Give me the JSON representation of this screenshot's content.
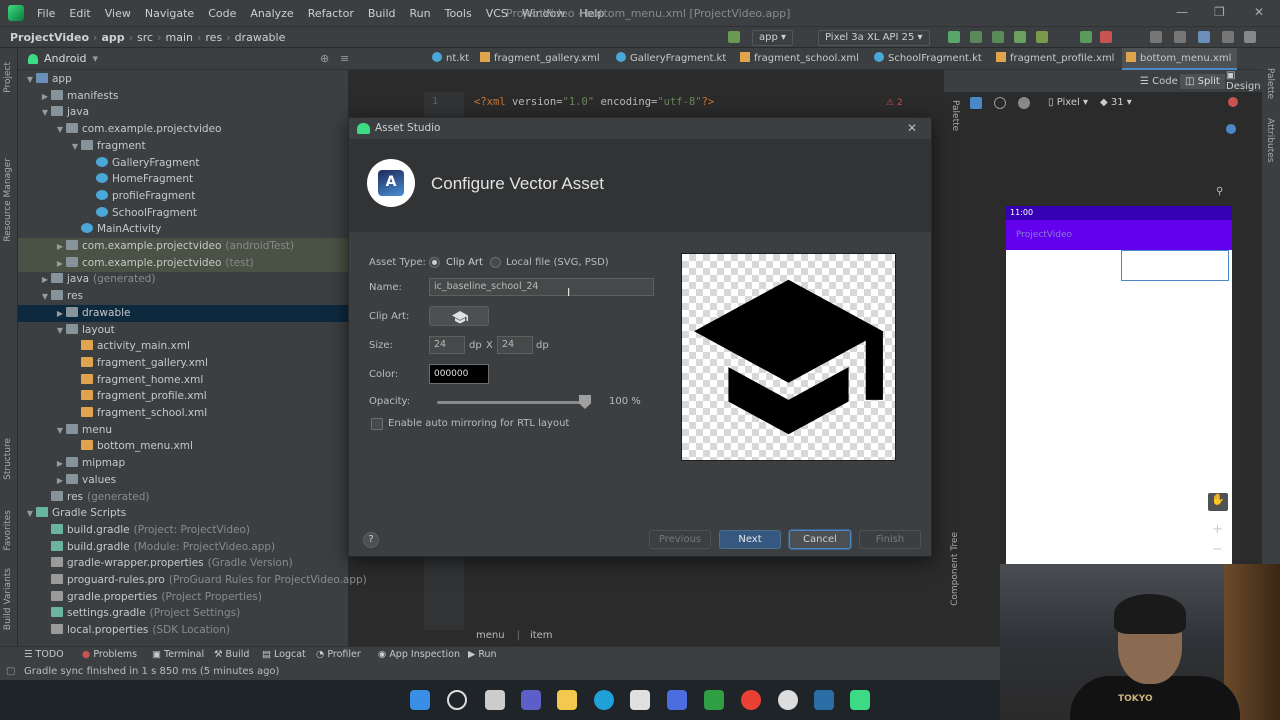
{
  "menubar": {
    "items": [
      "File",
      "Edit",
      "View",
      "Navigate",
      "Code",
      "Analyze",
      "Refactor",
      "Build",
      "Run",
      "Tools",
      "VCS",
      "Window",
      "Help"
    ],
    "window_title": "ProjectVideo - bottom_menu.xml [ProjectVideo.app]",
    "minimize": "—",
    "restore": "❐",
    "close": "✕"
  },
  "navbar": {
    "breadcrumbs": [
      "ProjectVideo",
      "app",
      "src",
      "main",
      "res",
      "drawable"
    ],
    "run_config": "app",
    "device": "Pixel 3a XL API 25"
  },
  "project_panel": {
    "view_mode": "Android",
    "tree": [
      {
        "label": "app",
        "extra": "",
        "level": 0,
        "arrow": "▼",
        "icon": "folder-b",
        "state": ""
      },
      {
        "label": "manifests",
        "extra": "",
        "level": 1,
        "arrow": "▶",
        "icon": "folder",
        "state": ""
      },
      {
        "label": "java",
        "extra": "",
        "level": 1,
        "arrow": "▼",
        "icon": "folder",
        "state": ""
      },
      {
        "label": "com.example.projectvideo",
        "extra": "",
        "level": 2,
        "arrow": "▼",
        "icon": "folder",
        "state": ""
      },
      {
        "label": "fragment",
        "extra": "",
        "level": 3,
        "arrow": "▼",
        "icon": "folder",
        "state": ""
      },
      {
        "label": "GalleryFragment",
        "extra": "",
        "level": 4,
        "arrow": "",
        "icon": "kt",
        "state": ""
      },
      {
        "label": "HomeFragment",
        "extra": "",
        "level": 4,
        "arrow": "",
        "icon": "kt",
        "state": ""
      },
      {
        "label": "profileFragment",
        "extra": "",
        "level": 4,
        "arrow": "",
        "icon": "kt",
        "state": ""
      },
      {
        "label": "SchoolFragment",
        "extra": "",
        "level": 4,
        "arrow": "",
        "icon": "kt",
        "state": ""
      },
      {
        "label": "MainActivity",
        "extra": "",
        "level": 3,
        "arrow": "",
        "icon": "kt",
        "state": ""
      },
      {
        "label": "com.example.projectvideo",
        "extra": "(androidTest)",
        "level": 2,
        "arrow": "▶",
        "icon": "folder",
        "state": "hl"
      },
      {
        "label": "com.example.projectvideo",
        "extra": "(test)",
        "level": 2,
        "arrow": "▶",
        "icon": "folder",
        "state": "hl"
      },
      {
        "label": "java",
        "extra": "(generated)",
        "level": 1,
        "arrow": "▶",
        "icon": "folder",
        "state": ""
      },
      {
        "label": "res",
        "extra": "",
        "level": 1,
        "arrow": "▼",
        "icon": "folder",
        "state": ""
      },
      {
        "label": "drawable",
        "extra": "",
        "level": 2,
        "arrow": "▶",
        "icon": "folder",
        "state": "sel"
      },
      {
        "label": "layout",
        "extra": "",
        "level": 2,
        "arrow": "▼",
        "icon": "folder",
        "state": ""
      },
      {
        "label": "activity_main.xml",
        "extra": "",
        "level": 3,
        "arrow": "",
        "icon": "xml",
        "state": ""
      },
      {
        "label": "fragment_gallery.xml",
        "extra": "",
        "level": 3,
        "arrow": "",
        "icon": "xml",
        "state": ""
      },
      {
        "label": "fragment_home.xml",
        "extra": "",
        "level": 3,
        "arrow": "",
        "icon": "xml",
        "state": ""
      },
      {
        "label": "fragment_profile.xml",
        "extra": "",
        "level": 3,
        "arrow": "",
        "icon": "xml",
        "state": ""
      },
      {
        "label": "fragment_school.xml",
        "extra": "",
        "level": 3,
        "arrow": "",
        "icon": "xml",
        "state": ""
      },
      {
        "label": "menu",
        "extra": "",
        "level": 2,
        "arrow": "▼",
        "icon": "folder",
        "state": ""
      },
      {
        "label": "bottom_menu.xml",
        "extra": "",
        "level": 3,
        "arrow": "",
        "icon": "xml",
        "state": ""
      },
      {
        "label": "mipmap",
        "extra": "",
        "level": 2,
        "arrow": "▶",
        "icon": "folder",
        "state": ""
      },
      {
        "label": "values",
        "extra": "",
        "level": 2,
        "arrow": "▶",
        "icon": "folder",
        "state": ""
      },
      {
        "label": "res",
        "extra": "(generated)",
        "level": 1,
        "arrow": "",
        "icon": "folder",
        "state": ""
      },
      {
        "label": "Gradle Scripts",
        "extra": "",
        "level": 0,
        "arrow": "▼",
        "icon": "gradle",
        "state": ""
      },
      {
        "label": "build.gradle",
        "extra": "(Project: ProjectVideo)",
        "level": 1,
        "arrow": "",
        "icon": "gradle",
        "state": ""
      },
      {
        "label": "build.gradle",
        "extra": "(Module: ProjectVideo.app)",
        "level": 1,
        "arrow": "",
        "icon": "gradle",
        "state": ""
      },
      {
        "label": "gradle-wrapper.properties",
        "extra": "(Gradle Version)",
        "level": 1,
        "arrow": "",
        "icon": "props",
        "state": ""
      },
      {
        "label": "proguard-rules.pro",
        "extra": "(ProGuard Rules for ProjectVideo.app)",
        "level": 1,
        "arrow": "",
        "icon": "props",
        "state": ""
      },
      {
        "label": "gradle.properties",
        "extra": "(Project Properties)",
        "level": 1,
        "arrow": "",
        "icon": "props",
        "state": ""
      },
      {
        "label": "settings.gradle",
        "extra": "(Project Settings)",
        "level": 1,
        "arrow": "",
        "icon": "gradle",
        "state": ""
      },
      {
        "label": "local.properties",
        "extra": "(SDK Location)",
        "level": 1,
        "arrow": "",
        "icon": "props",
        "state": ""
      }
    ]
  },
  "left_strip": {
    "project": "Project",
    "resource_manager": "Resource Manager",
    "structure": "Structure",
    "favorites": "Favorites",
    "build_variants": "Build Variants"
  },
  "right_strip": {
    "palette": "Palette",
    "attributes": "Attributes",
    "component_tree": "Component Tree"
  },
  "file_tabs": [
    {
      "label": "nt.kt",
      "icon": "kt",
      "active": false
    },
    {
      "label": "fragment_gallery.xml",
      "icon": "xml",
      "active": false
    },
    {
      "label": "GalleryFragment.kt",
      "icon": "kt",
      "active": false
    },
    {
      "label": "fragment_school.xml",
      "icon": "xml",
      "active": false
    },
    {
      "label": "SchoolFragment.kt",
      "icon": "kt",
      "active": false
    },
    {
      "label": "fragment_profile.xml",
      "icon": "xml",
      "active": false
    },
    {
      "label": "bottom_menu.xml",
      "icon": "xml",
      "active": true
    }
  ],
  "editor": {
    "line_number": "1",
    "xml_decl_open": "<?xml ",
    "version_attr": "version=",
    "version_val": "\"1.0\"",
    "encoding_attr": " encoding=",
    "encoding_val": "\"utf-8\"",
    "xml_decl_close": "?>",
    "problems_count": "2",
    "breadcrumb": [
      "menu",
      "item"
    ]
  },
  "design": {
    "modes": [
      "Code",
      "Split",
      "Design"
    ],
    "device": "Pixel",
    "api": "31",
    "phone_time": "11:00",
    "phone_title": "ProjectVideo"
  },
  "dialog": {
    "window_title": "Asset Studio",
    "heading": "Configure Vector Asset",
    "asset_type_label": "Asset Type:",
    "asset_type_options": [
      "Clip Art",
      "Local file (SVG, PSD)"
    ],
    "selected_asset_type": "Clip Art",
    "name_label": "Name:",
    "name_value": "ic_baseline_school_24",
    "clip_art_label": "Clip Art:",
    "clip_art_icon": "school-icon",
    "size_label": "Size:",
    "width": "24",
    "height": "24",
    "dp": "dp",
    "x": "X",
    "color_label": "Color:",
    "color_value": "000000",
    "opacity_label": "Opacity:",
    "opacity_percent": 100,
    "opacity_text": "100 %",
    "rtl_label": "Enable auto mirroring for RTL layout",
    "rtl_checked": false,
    "buttons": {
      "help": "?",
      "previous": "Previous",
      "next": "Next",
      "cancel": "Cancel",
      "finish": "Finish"
    }
  },
  "bottom_tools": [
    "TODO",
    "Problems",
    "Terminal",
    "Build",
    "Logcat",
    "Profiler",
    "App Inspection",
    "Run"
  ],
  "status_bar": {
    "message": "Gradle sync finished in 1 s 850 ms (5 minutes ago)"
  },
  "webcam": {
    "shirt_text": "TOKYO"
  },
  "colors": {
    "ide_bg": "#2b2b2b",
    "panel_bg": "#3c3f41",
    "accent_blue": "#365880",
    "purple_appbar": "#6200ee",
    "status_purple": "#3700b3"
  }
}
